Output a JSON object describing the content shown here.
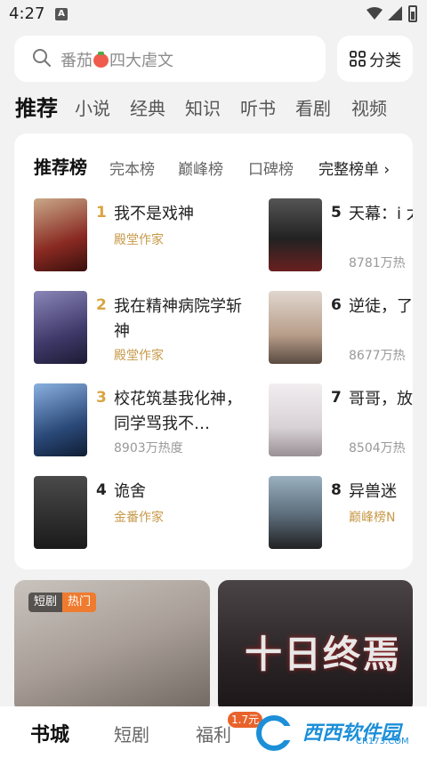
{
  "status_bar": {
    "time": "4:27",
    "notification_icon": "A"
  },
  "search": {
    "placeholder_before": "番茄",
    "placeholder_after": "四大虐文",
    "icon": "search-icon"
  },
  "category_button": {
    "label": "分类",
    "icon": "grid-icon"
  },
  "channel_tabs": [
    {
      "label": "推荐",
      "active": true
    },
    {
      "label": "小说"
    },
    {
      "label": "经典"
    },
    {
      "label": "知识"
    },
    {
      "label": "听书"
    },
    {
      "label": "看剧"
    },
    {
      "label": "视频"
    }
  ],
  "rank_tabs": [
    {
      "label": "推荐榜",
      "active": true
    },
    {
      "label": "完本榜"
    },
    {
      "label": "巅峰榜"
    },
    {
      "label": "口碑榜"
    },
    {
      "label": "完整榜单 ›"
    }
  ],
  "rank_items": [
    {
      "rank": "1",
      "title": "我不是戏神",
      "meta": "殿堂作家",
      "cover_color": "#8a2a22"
    },
    {
      "rank": "2",
      "title": "我在精神病院学斩神",
      "meta": "殿堂作家",
      "cover_color": "#3f3a6a"
    },
    {
      "rank": "3",
      "title": "校花筑基我化神，同学骂我不…",
      "meta": "8903万热度",
      "cover_color": "#2b4a7a"
    },
    {
      "rank": "4",
      "title": "诡舍",
      "meta": "金番作家",
      "cover_color": "#2a2a2a"
    },
    {
      "rank": "5",
      "title": "天幕：i 太子，",
      "meta": "8781万热",
      "cover_color": "#303030"
    },
    {
      "rank": "6",
      "title": "逆徒，了，这",
      "meta": "8677万热",
      "cover_color": "#b89e8a"
    },
    {
      "rank": "7",
      "title": "哥哥，放了什么",
      "meta": "8504万热",
      "cover_color": "#d8d2d6"
    },
    {
      "rank": "8",
      "title": "异兽迷",
      "meta": "巅峰榜N",
      "cover_color": "#5a6a78"
    }
  ],
  "banners": {
    "left": {
      "tag1": "短剧",
      "tag2": "热门"
    },
    "right": {
      "title": "十日终焉"
    }
  },
  "bottom_nav": [
    {
      "label": "书城",
      "active": true
    },
    {
      "label": "短剧"
    },
    {
      "label": "福利",
      "badge": "1.7元"
    }
  ],
  "watermark": {
    "text": "西西软件园",
    "sub": "CR173.COM"
  },
  "colors": {
    "accent_gold": "#d9a441",
    "badge_orange": "#ef7b2f",
    "background": "#f2f2f2"
  }
}
